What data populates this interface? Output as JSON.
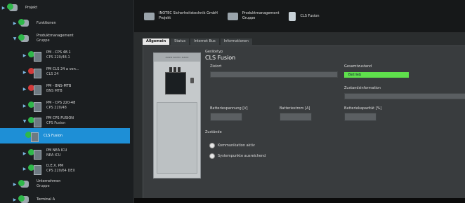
{
  "sidebar": {
    "top_item": "Projekt",
    "items": [
      {
        "l1": "Funktionen",
        "l2": ""
      },
      {
        "l1": "Produktmanagement",
        "l2": "Gruppe"
      },
      {
        "l1": "PM - CPS 48.1",
        "l2": "CPS 220/48.1"
      },
      {
        "l1": "PM CLS 24 a von...",
        "l2": "CLS 24"
      },
      {
        "l1": "PM - BNS-MTB",
        "l2": "BNS MTB"
      },
      {
        "l1": "PM - CPS 220-48",
        "l2": "CPS 220/48"
      },
      {
        "l1": "PM CPS FUSION",
        "l2": "CPS Fusion"
      },
      {
        "l1": "CLS Fusion",
        "l2": ""
      },
      {
        "l1": "PM NEA ICU",
        "l2": "NEA ICU"
      },
      {
        "l1": "D.E.X. PM",
        "l2": "CPS 220/64 DEX"
      },
      {
        "l1": "Unternehmen",
        "l2": "Gruppe"
      },
      {
        "l1": "Terminal A",
        "l2": ""
      }
    ]
  },
  "breadcrumb": {
    "items": [
      {
        "l1": "INOTEC Sicherheitstechnik GmbH",
        "l2": "Projekt"
      },
      {
        "l1": "Produktmanagement",
        "l2": "Gruppe"
      },
      {
        "l1": "CLS Fusion",
        "l2": ""
      }
    ]
  },
  "tabs": [
    "Allgemein",
    "Status",
    "Internet Bus",
    "Informationen"
  ],
  "details": {
    "device_type_label": "Gerätetyp",
    "device_type_value": "CLS Fusion",
    "device_top_text": "#### INOTEC ####",
    "zielort_label": "Zielort",
    "gesamt_label": "Gesamtzustand",
    "gesamt_value": "Betrieb",
    "zustand_info_label": "Zustandsinformation",
    "batt_v_label": "Batteriespannung [V]",
    "batt_a_label": "Batteriestrom [A]",
    "batt_kap_label": "Batteriekapazität [%]",
    "zustaende_label": "Zustände",
    "radio1": "Kommunikation aktiv",
    "radio2": "Systempunkte ausreichend"
  },
  "colors": {
    "selection": "#1e8fd6",
    "ok": "#5fe04c"
  }
}
